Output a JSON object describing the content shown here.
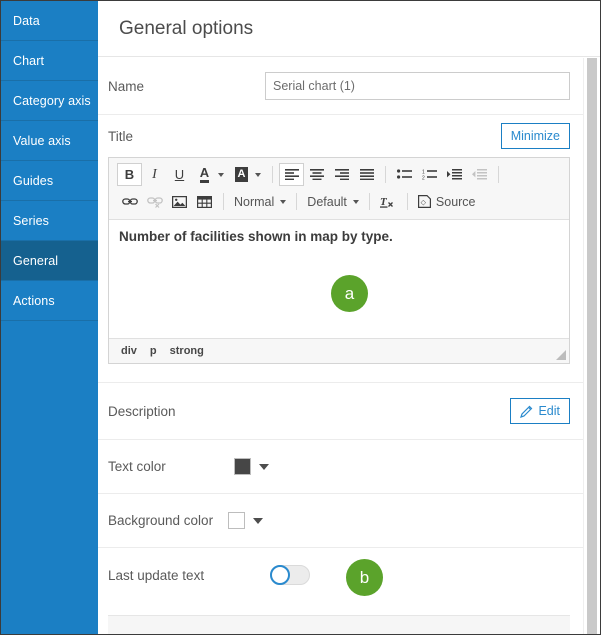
{
  "sidebar": {
    "items": [
      {
        "label": "Data",
        "selected": false
      },
      {
        "label": "Chart",
        "selected": false
      },
      {
        "label": "Category axis",
        "selected": false
      },
      {
        "label": "Value axis",
        "selected": false
      },
      {
        "label": "Guides",
        "selected": false
      },
      {
        "label": "Series",
        "selected": false
      },
      {
        "label": "General",
        "selected": true
      },
      {
        "label": "Actions",
        "selected": false
      }
    ]
  },
  "header": {
    "title": "General options"
  },
  "form": {
    "name": {
      "label": "Name",
      "value": "Serial chart (1)",
      "placeholder": "Serial chart (1)"
    },
    "title": {
      "label": "Title",
      "minimize_label": "Minimize"
    },
    "description": {
      "label": "Description",
      "edit_label": "Edit"
    },
    "text_color": {
      "label": "Text color",
      "value": "#464646"
    },
    "background_color": {
      "label": "Background color",
      "value": "#ffffff"
    },
    "last_update_text": {
      "label": "Last update text",
      "state": "off"
    }
  },
  "editor": {
    "toolbar": {
      "bold": "B",
      "italic": "I",
      "underline": "U",
      "text_color": "A",
      "background_color": "A",
      "align_left": "align-left-icon",
      "align_center": "align-center-icon",
      "align_right": "align-right-icon",
      "align_justify": "align-justify-icon",
      "bulleted_list": "bulleted-list-icon",
      "numbered_list": "numbered-list-icon",
      "increase_indent": "increase-indent-icon",
      "decrease_indent": "decrease-indent-icon",
      "link": "link-icon",
      "unlink": "unlink-icon",
      "image": "image-icon",
      "table": "table-icon",
      "paragraph_format": "Normal",
      "font_size": "Default",
      "remove_format": "remove-format-icon",
      "source_label": "Source"
    },
    "content": "Number of facilities shown in map by type.",
    "status_path": [
      "div",
      "p",
      "strong"
    ]
  },
  "annotations": [
    {
      "id": "a",
      "label": "a",
      "color": "#5ba32b"
    },
    {
      "id": "b",
      "label": "b",
      "color": "#5ba32b"
    }
  ]
}
